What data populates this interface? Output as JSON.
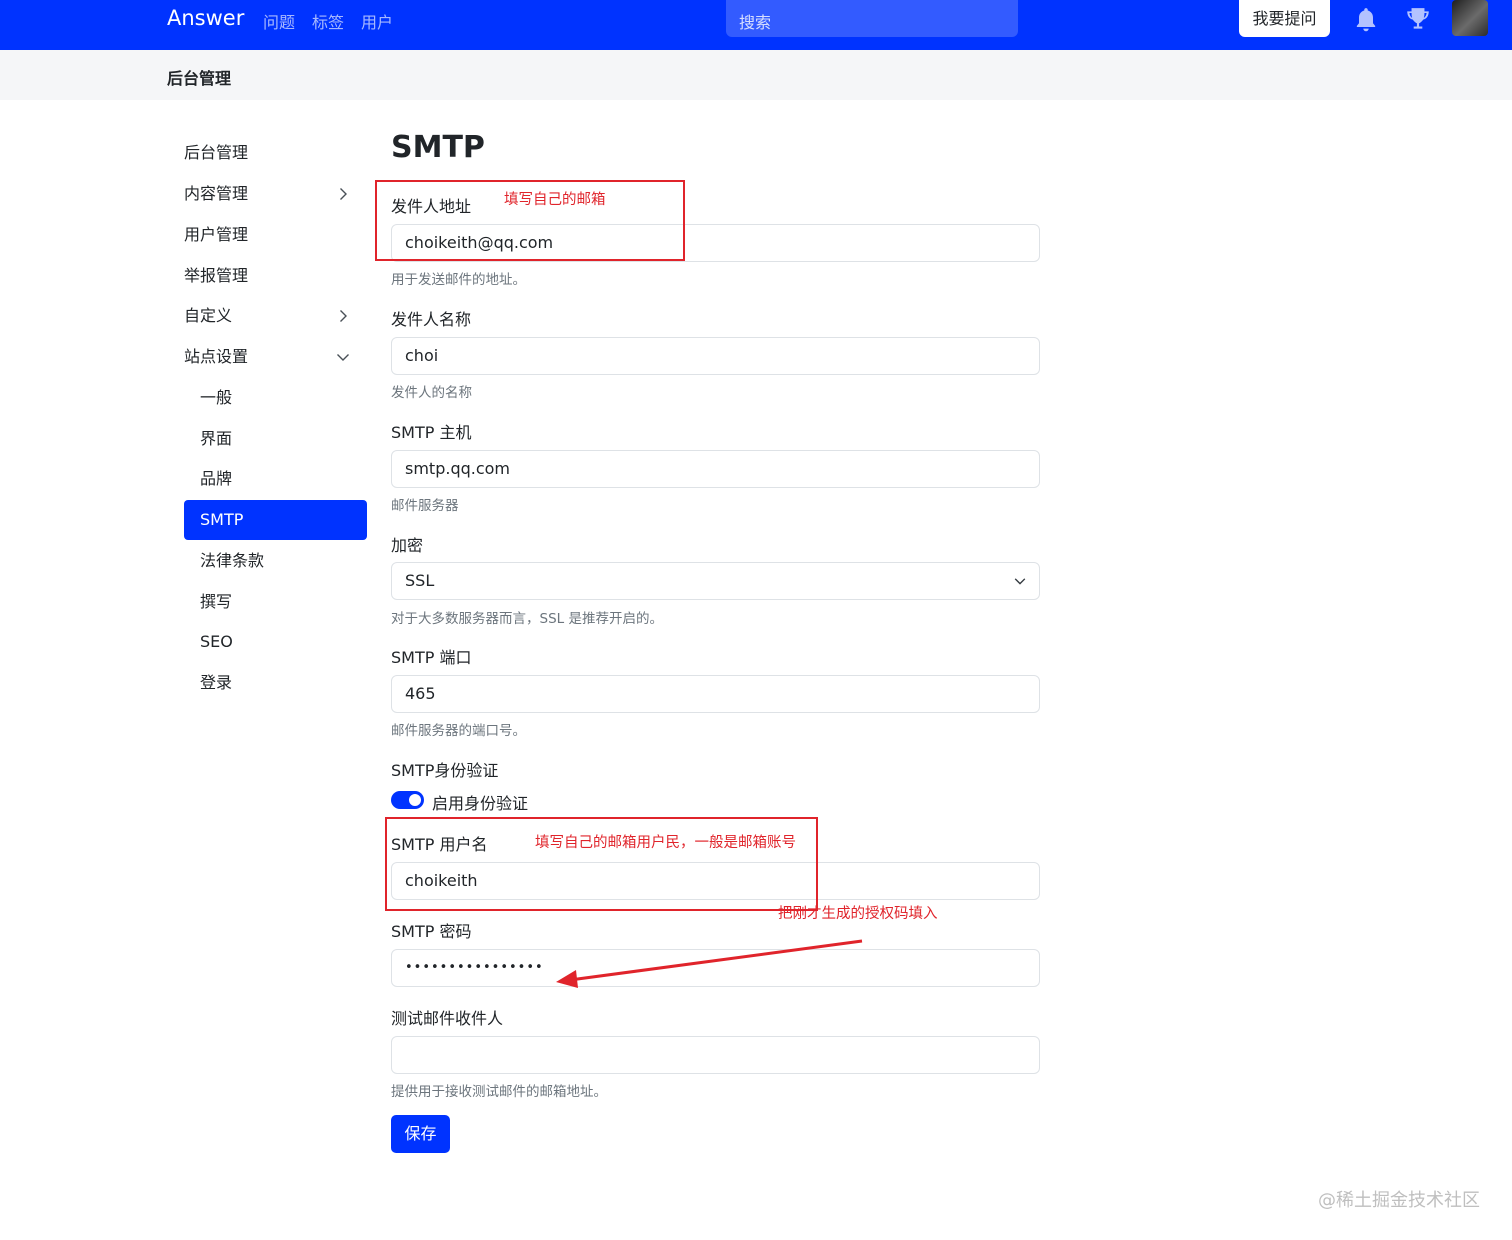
{
  "navbar": {
    "brand": "Answer",
    "links": [
      "问题",
      "标签",
      "用户"
    ],
    "search_placeholder": "搜索",
    "ask_button": "我要提问",
    "icons": [
      "bell-icon",
      "trophy-icon"
    ]
  },
  "subheader": {
    "title": "后台管理"
  },
  "sidebar": {
    "items": [
      {
        "label": "后台管理"
      },
      {
        "label": "内容管理",
        "chevron": "right"
      },
      {
        "label": "用户管理"
      },
      {
        "label": "举报管理"
      },
      {
        "label": "自定义",
        "chevron": "right"
      },
      {
        "label": "站点设置",
        "chevron": "down"
      },
      {
        "label": "一般"
      },
      {
        "label": "界面"
      },
      {
        "label": "品牌"
      },
      {
        "label": "SMTP",
        "active": true
      },
      {
        "label": "法律条款"
      },
      {
        "label": "撰写"
      },
      {
        "label": "SEO"
      },
      {
        "label": "登录"
      }
    ]
  },
  "form": {
    "title": "SMTP",
    "from_email": {
      "label": "发件人地址",
      "value": "choikeith@qq.com",
      "hint": "用于发送邮件的地址。"
    },
    "from_name": {
      "label": "发件人名称",
      "value": "choi",
      "hint": "发件人的名称"
    },
    "smtp_host": {
      "label": "SMTP 主机",
      "value": "smtp.qq.com",
      "hint": "邮件服务器"
    },
    "encryption": {
      "label": "加密",
      "value": "SSL",
      "hint": "对于大多数服务器而言，SSL 是推荐开启的。"
    },
    "smtp_port": {
      "label": "SMTP 端口",
      "value": "465",
      "hint": "邮件服务器的端口号。"
    },
    "smtp_auth": {
      "label": "SMTP身份验证",
      "toggle_label": "启用身份验证",
      "enabled": true
    },
    "smtp_username": {
      "label": "SMTP 用户名",
      "value": "choikeith"
    },
    "smtp_password": {
      "label": "SMTP 密码",
      "value": "••••••••••••••••"
    },
    "test_recipient": {
      "label": "测试邮件收件人",
      "value": "",
      "hint": "提供用于接收测试邮件的邮箱地址。"
    },
    "save_button": "保存"
  },
  "annotations": {
    "note1": "填写自己的邮箱",
    "note2": "填写自己的邮箱用户民，一般是邮箱账号",
    "note3": "把刚才生成的授权码填入",
    "color": "#e0242b"
  },
  "watermark": "@稀土掘金技术社区",
  "colors": {
    "primary": "#0033ff"
  }
}
